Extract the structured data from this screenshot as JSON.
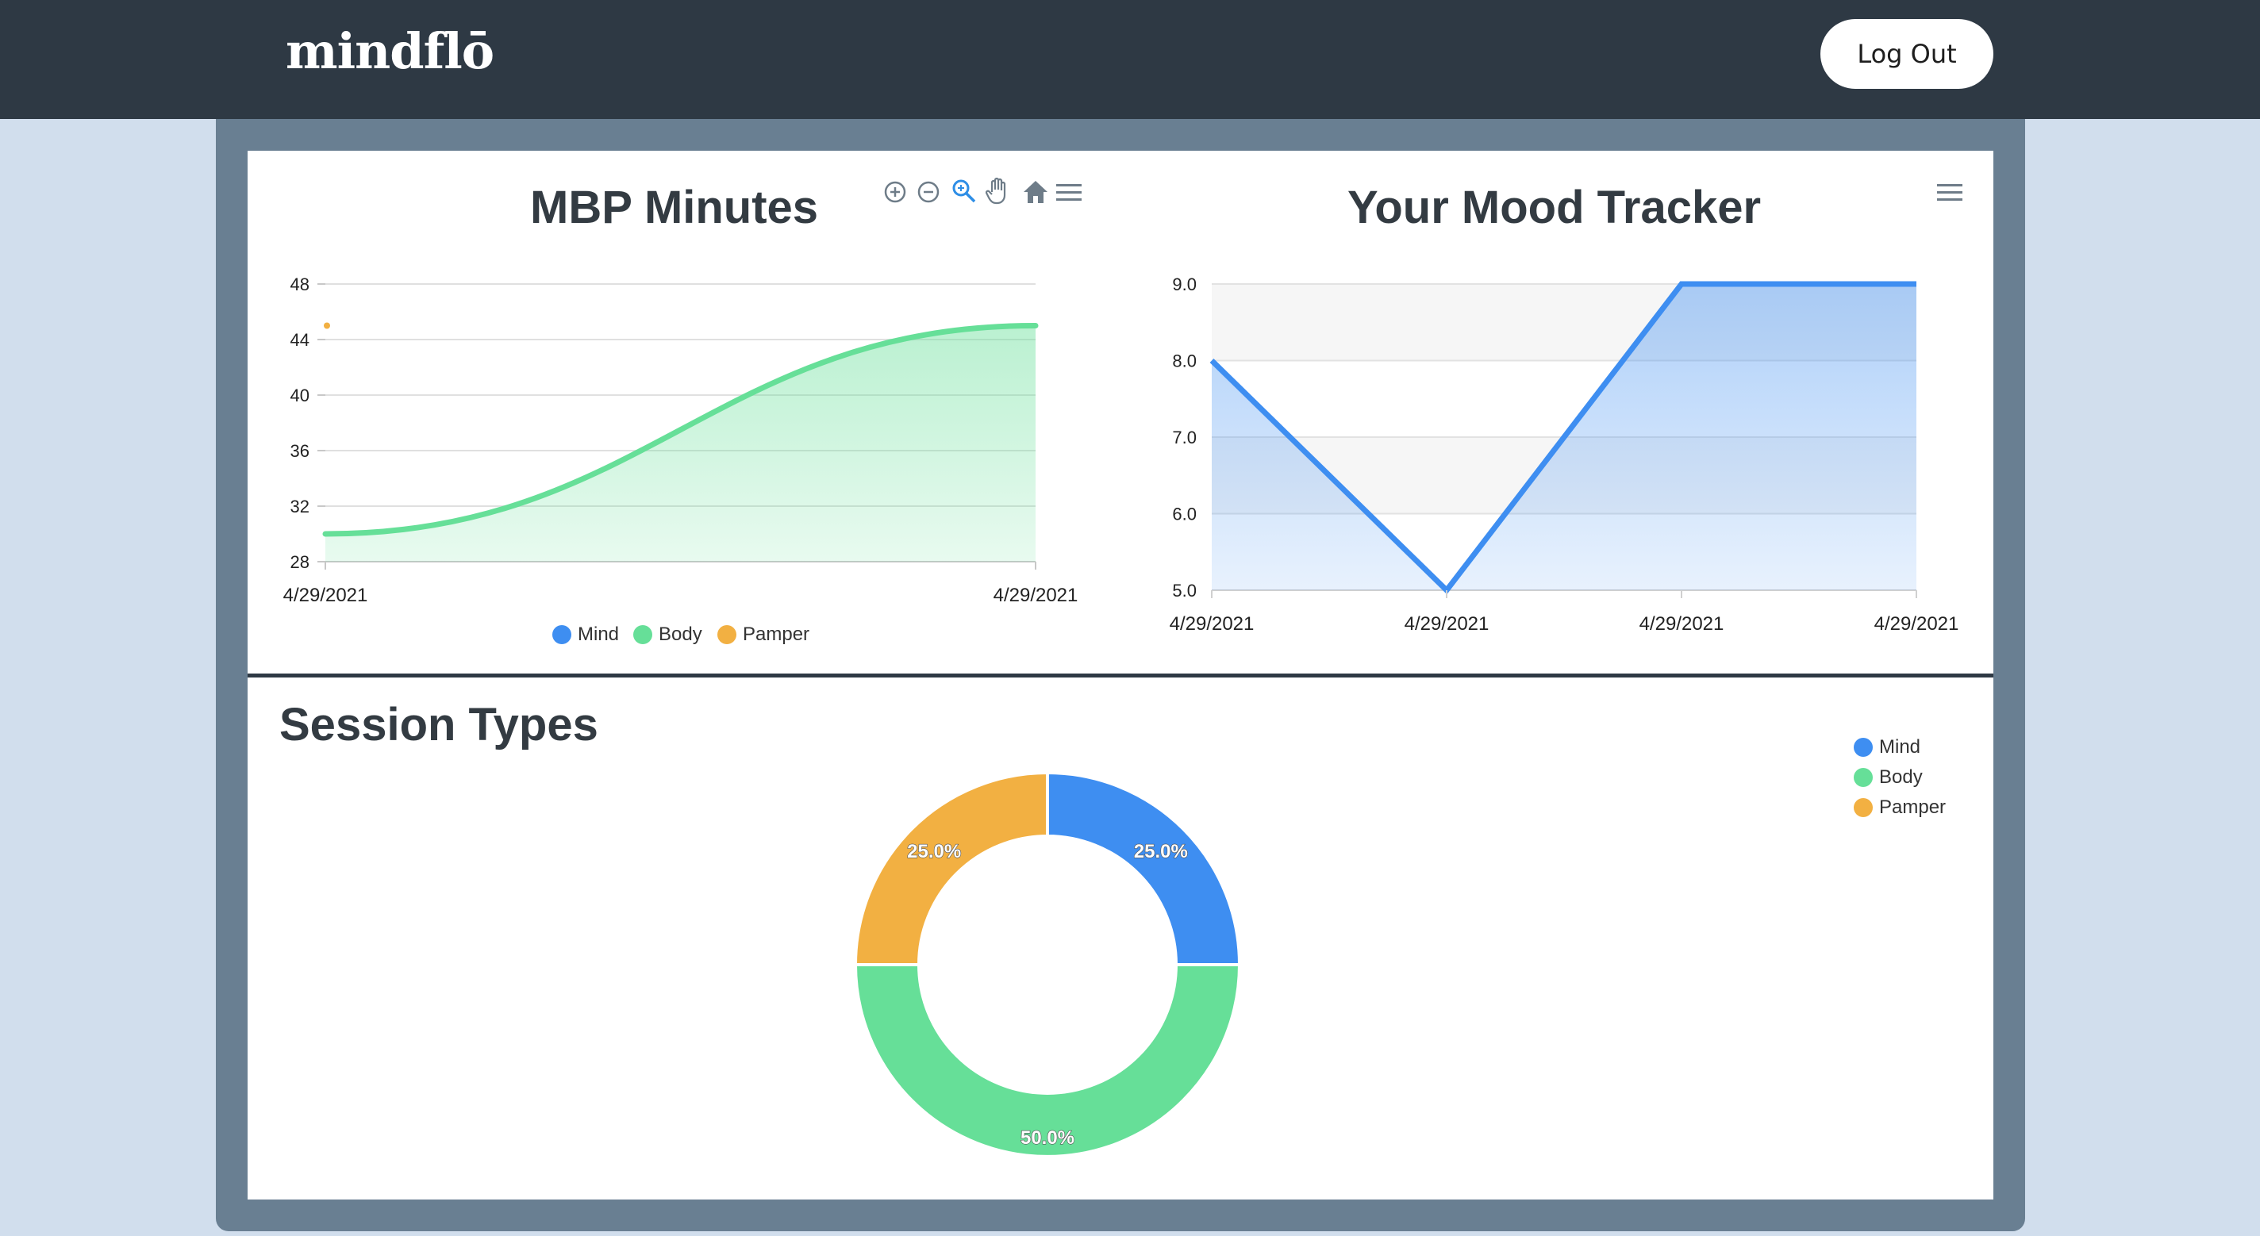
{
  "header": {
    "brand": "mindflō",
    "logout_label": "Log Out"
  },
  "colors": {
    "header_bg": "#2e3944",
    "page_bg": "#d1deed",
    "frame": "#697f92",
    "mind": "#3e8ef1",
    "body": "#66df98",
    "pamper": "#f2b042"
  },
  "mbp_chart": {
    "title": "MBP Minutes",
    "toolbar": [
      "zoom-in-icon",
      "zoom-out-icon",
      "magnifier-icon",
      "pan-hand-icon",
      "home-icon",
      "menu-icon"
    ],
    "legend": [
      "Mind",
      "Body",
      "Pamper"
    ]
  },
  "mood_chart": {
    "title": "Your Mood Tracker",
    "toolbar": [
      "menu-icon"
    ]
  },
  "session_chart": {
    "title": "Session Types",
    "legend": [
      "Mind",
      "Body",
      "Pamper"
    ]
  },
  "chart_data": [
    {
      "type": "area",
      "title": "MBP Minutes",
      "xlabel": "",
      "ylabel": "",
      "ylim": [
        28,
        48
      ],
      "yticks": [
        28,
        32,
        36,
        40,
        44,
        48
      ],
      "x_tick_labels": [
        "4/29/2021",
        "4/29/2021"
      ],
      "series": [
        {
          "name": "Mind",
          "values": []
        },
        {
          "name": "Body",
          "x": [
            0,
            1
          ],
          "values": [
            30,
            45
          ],
          "curve": "smooth"
        },
        {
          "name": "Pamper",
          "x": [
            0
          ],
          "values": [
            45
          ]
        }
      ],
      "grid": true,
      "legend_position": "bottom"
    },
    {
      "type": "area",
      "title": "Your Mood Tracker",
      "xlabel": "",
      "ylabel": "",
      "ylim": [
        5.0,
        9.0
      ],
      "yticks": [
        "5.0",
        "6.0",
        "7.0",
        "8.0",
        "9.0"
      ],
      "categories": [
        "4/29/2021",
        "4/29/2021",
        "4/29/2021",
        "4/29/2021"
      ],
      "values": [
        8,
        5,
        9,
        9
      ],
      "grid": true
    },
    {
      "type": "pie",
      "title": "Session Types",
      "donut": true,
      "categories": [
        "Mind",
        "Body",
        "Pamper"
      ],
      "values": [
        25.0,
        50.0,
        25.0
      ],
      "labels": [
        "25.0%",
        "50.0%",
        "25.0%"
      ],
      "legend_position": "top-right"
    }
  ]
}
